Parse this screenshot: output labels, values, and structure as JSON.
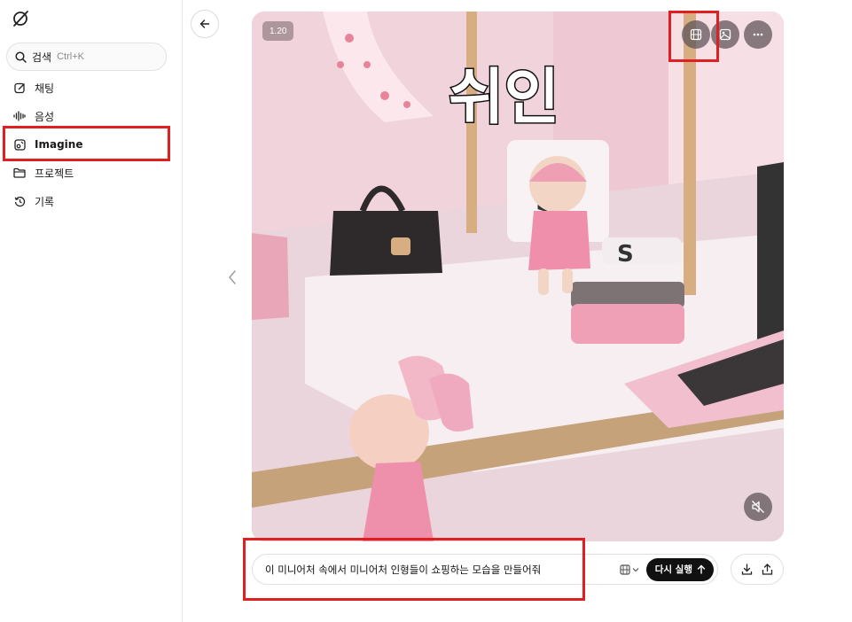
{
  "sidebar": {
    "search": {
      "label": "검색",
      "shortcut": "Ctrl+K"
    },
    "items": [
      {
        "label": "채팅",
        "icon": "chat-edit-icon"
      },
      {
        "label": "음성",
        "icon": "voice-wave-icon"
      },
      {
        "label": "Imagine",
        "icon": "imagine-icon",
        "active": true
      },
      {
        "label": "프로젝트",
        "icon": "folder-icon"
      },
      {
        "label": "기록",
        "icon": "history-icon"
      }
    ]
  },
  "viewer": {
    "badge": "1.20",
    "overlay_text": "쉬인",
    "top_buttons": [
      "video-icon",
      "image-icon",
      "more-icon"
    ],
    "mute_icon": "muted-speaker-icon"
  },
  "prompt": {
    "text": "이 미니어처 속에서 미니어처 인형들이 쇼핑하는 모습을 만들어줘",
    "rerun_label": "다시 실행"
  },
  "colors": {
    "highlight": "#e02020",
    "scene_pink": "#f3d9e0",
    "button_dark": "#111111"
  }
}
